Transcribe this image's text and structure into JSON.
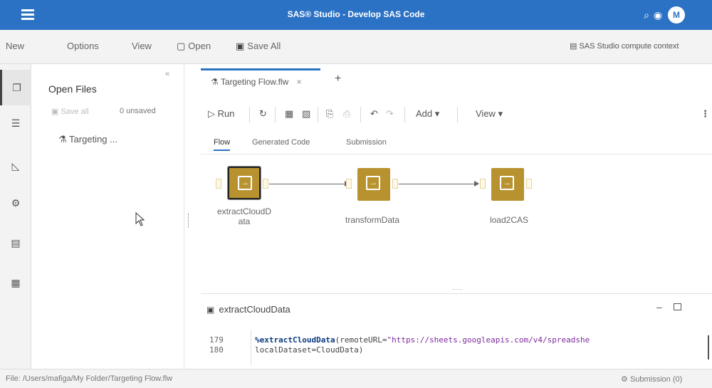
{
  "app": {
    "title": "SAS® Studio - Develop SAS Code",
    "avatar_initial": "M"
  },
  "menu": {
    "new": "New",
    "options": "Options",
    "view": "View",
    "open": "Open",
    "save_all": "Save All",
    "context": "SAS Studio compute context"
  },
  "rail": {
    "items": [
      "files-icon",
      "document-icon",
      "chart-icon",
      "gear-icon",
      "clipboard-icon",
      "library-icon"
    ]
  },
  "open_files": {
    "heading": "Open Files",
    "collapse": "«",
    "save_all": "Save all",
    "unsaved": "0 unsaved",
    "file_item": "Targeting ..."
  },
  "editor_tab": {
    "label": "Targeting Flow.flw",
    "close": "×",
    "add": "+"
  },
  "toolbar": {
    "run": "Run",
    "add": "Add",
    "view": "View",
    "more": "⋮"
  },
  "subtabs": [
    "Flow",
    "Generated Code",
    "Submission"
  ],
  "flow": {
    "nodes": [
      {
        "label_line1": "extractCloudD",
        "label_line2": "ata"
      },
      {
        "label_line1": "transformData",
        "label_line2": ""
      },
      {
        "label_line1": "load2CAS",
        "label_line2": ""
      }
    ]
  },
  "code_panel": {
    "title": "extractCloudData",
    "lines": [
      {
        "num": "179",
        "macro": "%extractCloudData",
        "text": "(remoteURL=",
        "str": "\"https://sheets.googleapis.com/v4/spreadshe"
      },
      {
        "num": "180",
        "macro": "",
        "text": "localDataset=CloudData)",
        "str": ""
      }
    ]
  },
  "status": {
    "path": "File: /Users/mafiga/My Folder/Targeting Flow.flw",
    "submission": "Submission (0)"
  },
  "colors": {
    "titlebar": "#2c72c4",
    "node": "#b8922f",
    "accent": "#2c72c4"
  }
}
